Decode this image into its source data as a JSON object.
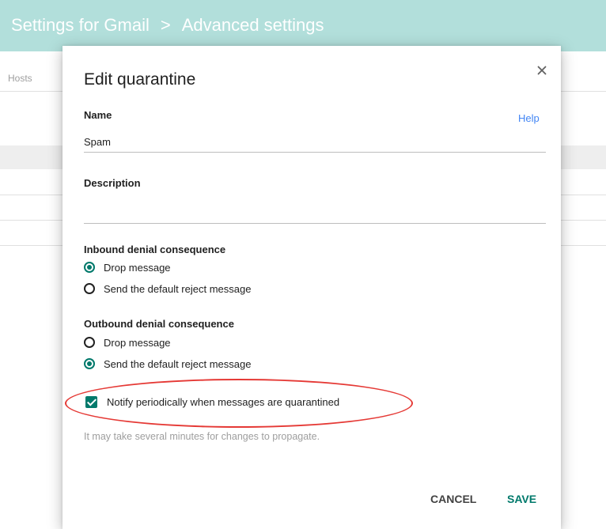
{
  "header": {
    "crumb_1": "Settings for Gmail",
    "separator": ">",
    "crumb_2": "Advanced settings"
  },
  "background": {
    "hosts_label": "Hosts"
  },
  "dialog": {
    "title": "Edit quarantine",
    "close_icon": "close-icon",
    "help_label": "Help",
    "name_label": "Name",
    "name_value": "Spam",
    "description_label": "Description",
    "description_value": "",
    "inbound": {
      "heading": "Inbound denial consequence",
      "options": [
        {
          "label": "Drop message",
          "selected": true
        },
        {
          "label": "Send the default reject message",
          "selected": false
        }
      ]
    },
    "outbound": {
      "heading": "Outbound denial consequence",
      "options": [
        {
          "label": "Drop message",
          "selected": false
        },
        {
          "label": "Send the default reject message",
          "selected": true
        }
      ]
    },
    "notify_checkbox_label": "Notify periodically when messages are quarantined",
    "notify_checked": true,
    "note": "It may take several minutes for changes to propagate.",
    "cancel_label": "CANCEL",
    "save_label": "SAVE"
  },
  "colors": {
    "header_bg": "#b2dfdb",
    "accent": "#00796b",
    "link": "#4285f4",
    "annotation": "#e53935"
  }
}
